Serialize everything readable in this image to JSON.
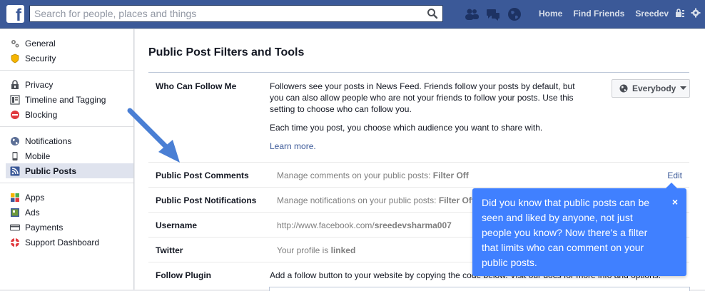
{
  "topbar": {
    "logo": "f",
    "search_placeholder": "Search for people, places and things",
    "nav": [
      "Home",
      "Find Friends",
      "Sreedev"
    ]
  },
  "sidebar": {
    "groups": [
      [
        {
          "label": "General",
          "icon": "gear-icon"
        },
        {
          "label": "Security",
          "icon": "shield-icon"
        }
      ],
      [
        {
          "label": "Privacy",
          "icon": "lock-icon"
        },
        {
          "label": "Timeline and Tagging",
          "icon": "timeline-icon"
        },
        {
          "label": "Blocking",
          "icon": "blocking-icon"
        }
      ],
      [
        {
          "label": "Notifications",
          "icon": "globe-icon"
        },
        {
          "label": "Mobile",
          "icon": "mobile-icon"
        },
        {
          "label": "Public Posts",
          "icon": "rss-icon",
          "active": true
        }
      ],
      [
        {
          "label": "Apps",
          "icon": "apps-icon"
        },
        {
          "label": "Ads",
          "icon": "ads-icon"
        },
        {
          "label": "Payments",
          "icon": "payments-icon"
        },
        {
          "label": "Support Dashboard",
          "icon": "lifebuoy-icon"
        }
      ]
    ]
  },
  "main": {
    "title": "Public Post Filters and Tools",
    "follow": {
      "label": "Who Can Follow Me",
      "desc1": "Followers see your posts in News Feed. Friends follow your posts by default, but you can also allow people who are not your friends to follow your posts. Use this setting to choose who can follow you.",
      "desc2": "Each time you post, you choose which audience you want to share with.",
      "learn_more": "Learn more.",
      "audience": "Everybody"
    },
    "comments": {
      "label": "Public Post Comments",
      "desc": "Manage comments on your public posts: ",
      "value": "Filter Off",
      "edit": "Edit"
    },
    "notifications": {
      "label": "Public Post Notifications",
      "desc": "Manage notifications on your public posts: ",
      "value": "Filter Off"
    },
    "username": {
      "label": "Username",
      "desc": "http://www.facebook.com/",
      "value": "sreedevsharma007"
    },
    "twitter": {
      "label": "Twitter",
      "desc": "Your profile is ",
      "value": "linked"
    },
    "plugin": {
      "label": "Follow Plugin",
      "desc": "Add a follow button to your website by copying the code below. Visit our docs for more info and options."
    }
  },
  "tooltip": {
    "text": "Did you know that public posts can be seen and liked by anyone, not just people you know? Now there's a filter that limits who can comment on your public posts.",
    "close": "×"
  },
  "colors": {
    "brand": "#3b5998",
    "tooltip": "#4080ff",
    "arrow": "#4a7fd4"
  }
}
